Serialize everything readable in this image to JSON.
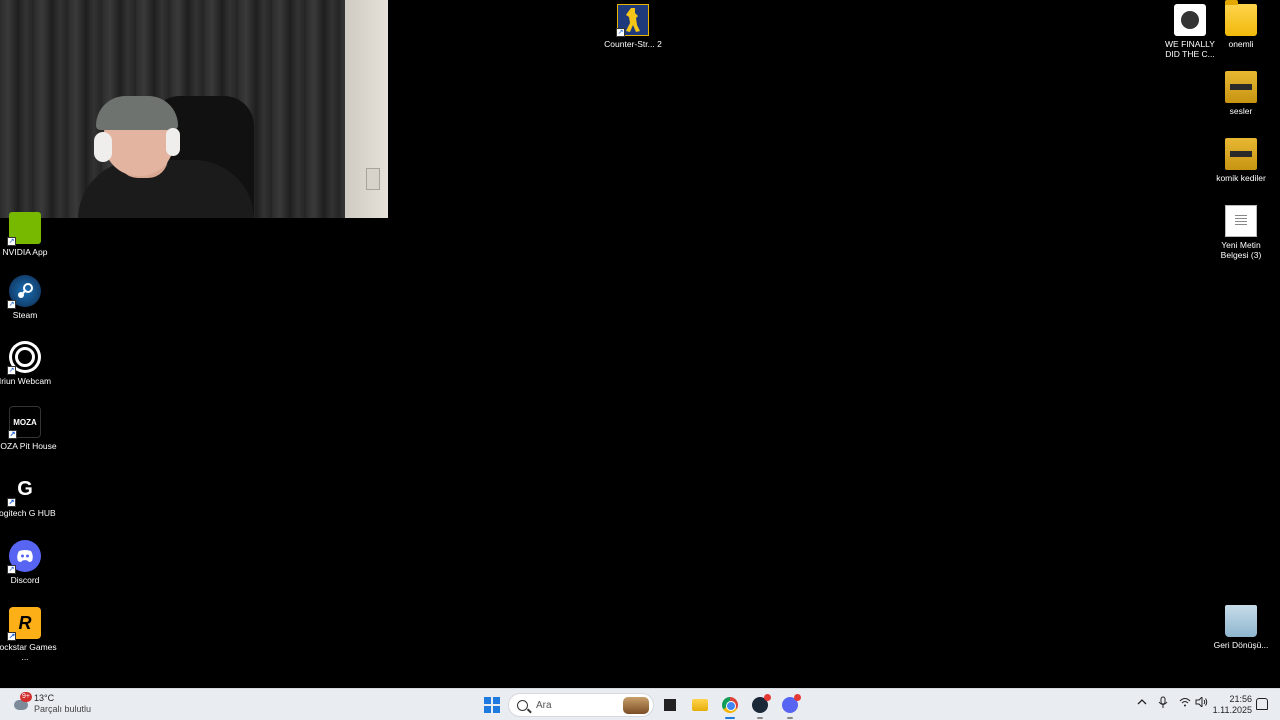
{
  "desktop": {
    "left_icons": [
      {
        "name": "nvidia-app",
        "label": "NVIDIA App"
      },
      {
        "name": "steam",
        "label": "Steam"
      },
      {
        "name": "iriun-webcam",
        "label": "Iriun Webcam"
      },
      {
        "name": "moza-pit-house",
        "label": "MOZA Pit House",
        "glyph_text": "MOZA"
      },
      {
        "name": "logitech-g-hub",
        "label": "Logitech G HUB",
        "glyph_text": "G"
      },
      {
        "name": "discord",
        "label": "Discord"
      },
      {
        "name": "rockstar-games",
        "label": "Rockstar Games ...",
        "glyph_text": "R"
      }
    ],
    "center_icon": {
      "label": "Counter-Str... 2"
    },
    "right_icons": [
      {
        "label": "WE FINALLY DID THE C..."
      },
      {
        "label": "onemli"
      },
      {
        "label": "sesler"
      },
      {
        "label": "komik kediler"
      },
      {
        "label": "Yeni Metin Belgesi (3)"
      },
      {
        "label": "Geri Dönüşü..."
      }
    ]
  },
  "taskbar": {
    "weather": {
      "temp": "13°C",
      "condition": "Parçalı bulutlu",
      "badge": "9+"
    },
    "search": {
      "placeholder": "Ara"
    },
    "apps": [
      "start",
      "search",
      "task-view",
      "file-explorer",
      "chrome",
      "steam",
      "discord"
    ],
    "clock": {
      "time": "21:56",
      "date": "1.11.2025"
    },
    "tray_icons": [
      "chevron-up-icon",
      "microphone-icon",
      "wifi-icon",
      "volume-icon",
      "notification-icon"
    ]
  },
  "colors": {
    "desktop_bg": "#000000",
    "taskbar_bg": "#e9edf2",
    "accent": "#1f7ae0"
  }
}
